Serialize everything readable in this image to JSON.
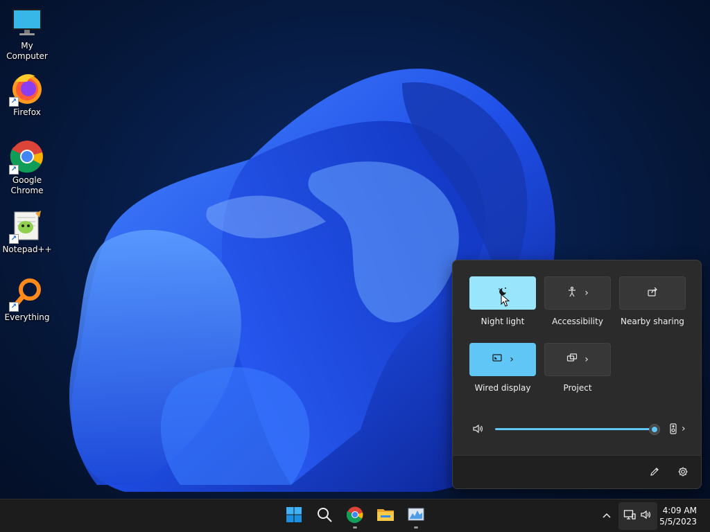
{
  "desktop": {
    "icons": [
      {
        "label": "My Computer",
        "icon": "computer-icon"
      },
      {
        "label": "Firefox",
        "icon": "firefox-icon"
      },
      {
        "label": "Google Chrome",
        "icon": "chrome-icon"
      },
      {
        "label": "Notepad++",
        "icon": "notepad-plus-plus-icon"
      },
      {
        "label": "Everything",
        "icon": "search-magnifier-icon"
      }
    ]
  },
  "quick_settings": {
    "tiles": [
      {
        "label": "Night light",
        "icon": "brightness-moon-icon",
        "active": true,
        "has_chevron": false
      },
      {
        "label": "Accessibility",
        "icon": "accessibility-icon",
        "active": false,
        "has_chevron": true
      },
      {
        "label": "Nearby sharing",
        "icon": "share-icon",
        "active": false,
        "has_chevron": false
      },
      {
        "label": "Wired display",
        "icon": "cast-icon",
        "active": true,
        "has_chevron": true
      },
      {
        "label": "Project",
        "icon": "project-screens-icon",
        "active": false,
        "has_chevron": true
      }
    ],
    "volume": {
      "level": 1.0,
      "icon": "speaker-icon",
      "output_icon": "speaker-device-icon"
    },
    "footer": {
      "edit_icon": "pencil-icon",
      "settings_icon": "gear-icon"
    },
    "accent": "#5fc6f6",
    "active_tile_color": "#99e5fb"
  },
  "taskbar": {
    "apps": [
      "windows-start-icon",
      "search-icon",
      "chrome-icon",
      "file-explorer-icon",
      "task-manager-icon"
    ],
    "tray": {
      "overflow_icon": "chevron-up-icon",
      "network_icon": "network-icon",
      "volume_icon": "speaker-icon"
    },
    "clock": {
      "time": "4:09 AM",
      "date": "5/5/2023"
    }
  }
}
